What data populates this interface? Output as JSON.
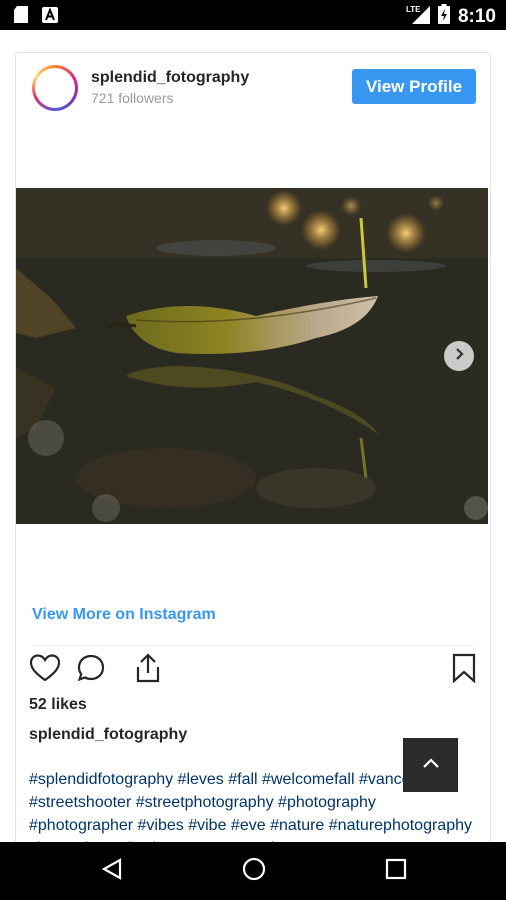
{
  "status_bar": {
    "time": "8:10",
    "left_icons": [
      "sd-card-icon",
      "text-app-icon"
    ],
    "right_icons": [
      "lte-signal-icon",
      "battery-icon"
    ]
  },
  "post": {
    "username": "splendid_fotography",
    "followers": "721 followers",
    "view_profile_label": "View Profile",
    "image_subject": "dry leaf floating on water with bokeh lights",
    "view_more_label": "View More on Instagram",
    "likes": "52 likes",
    "caption_user": "splendid_fotography",
    "hashtags": "#splendidfotography #leves #fall #welcomefall #vancouver #streetshooter #streetphotography #photography #photographer #vibes #vibe #eve #nature #naturephotography #insta #instapic #instagram #gpeview"
  },
  "colors": {
    "accent": "#3897f0",
    "hashtag": "#003569",
    "text": "#262626",
    "muted": "#9a9a9a"
  }
}
